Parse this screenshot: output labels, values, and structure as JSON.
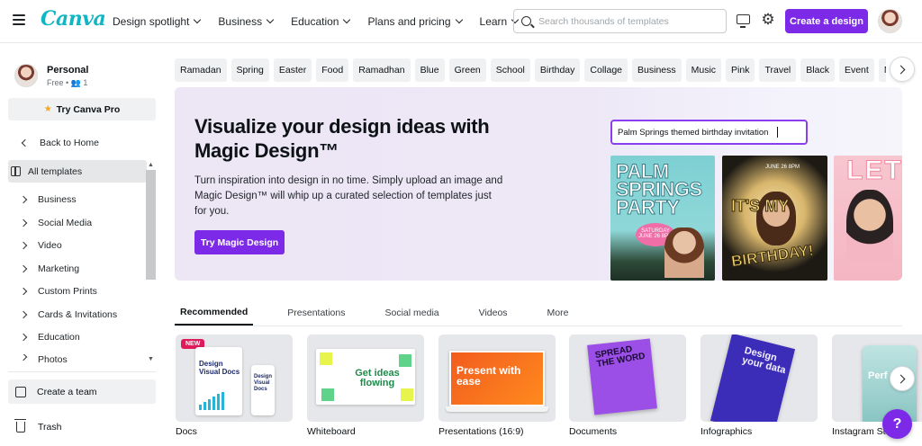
{
  "app": {
    "logo": "Canva"
  },
  "nav": {
    "items": [
      "Design spotlight",
      "Business",
      "Education",
      "Plans and pricing",
      "Learn"
    ]
  },
  "search": {
    "placeholder": "Search thousands of templates",
    "icon": "search-icon"
  },
  "header": {
    "create_label": "Create a design",
    "accent_color": "#7d2ae8"
  },
  "profile": {
    "name": "Personal",
    "sub": "Free • 👥 1"
  },
  "sidebar": {
    "pro_label": "Try Canva Pro",
    "back_label": "Back to Home",
    "active_label": "All templates",
    "items": [
      "Business",
      "Social Media",
      "Video",
      "Marketing",
      "Custom Prints",
      "Cards & Invitations",
      "Education",
      "Photos"
    ],
    "team_label": "Create a team",
    "trash_label": "Trash"
  },
  "chips": [
    "Ramadan",
    "Spring",
    "Easter",
    "Food",
    "Ramadhan",
    "Blue",
    "Green",
    "School",
    "Birthday",
    "Collage",
    "Business",
    "Music",
    "Pink",
    "Travel",
    "Black",
    "Event",
    "Nature"
  ],
  "hero": {
    "title": "Visualize your design ideas with Magic Design™",
    "description": "Turn inspiration into design in no time. Simply upload an image and Magic Design™ will whip up a curated selection of templates just for you.",
    "button": "Try Magic Design",
    "prompt": "Palm Springs themed birthday invitation",
    "tpl1_title": "PALM SPRINGS PARTY",
    "tpl1_date": "SATURDAY JUNE 26 8PM",
    "tpl2_date": "JUNE 26 8PM",
    "tpl2_title1": "IT'S MY",
    "tpl2_title2": "BIRTHDAY!",
    "tpl3_title": "LET'S"
  },
  "tabs": [
    "Recommended",
    "Presentations",
    "Social media",
    "Videos",
    "More"
  ],
  "cards": [
    {
      "label": "Docs",
      "badge": "NEW",
      "art": "Design Visual Docs",
      "art_small": "Design Visual Docs"
    },
    {
      "label": "Whiteboard",
      "art": "Get ideas flowing"
    },
    {
      "label": "Presentations (16:9)",
      "art": "Present with ease"
    },
    {
      "label": "Documents",
      "art": "SPREAD THE WORD"
    },
    {
      "label": "Infographics",
      "art": "Design your data"
    },
    {
      "label": "Instagram Story",
      "art": "Perf post"
    }
  ],
  "help": {
    "label": "?"
  }
}
